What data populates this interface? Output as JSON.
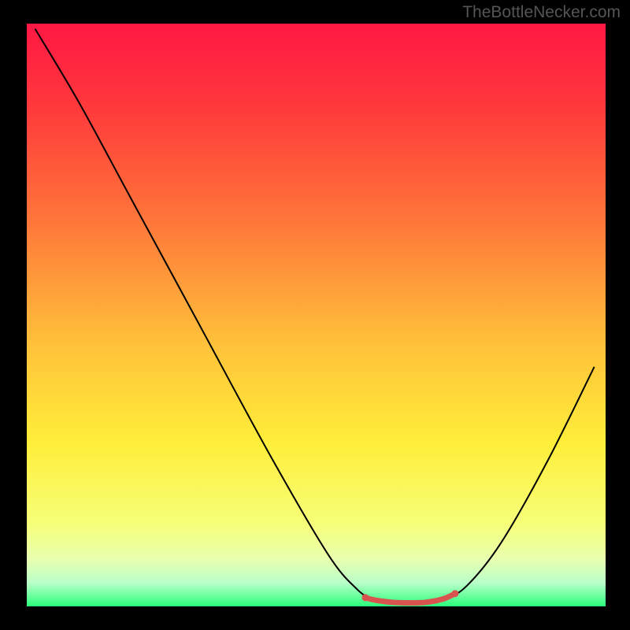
{
  "watermark": "TheBottleNecker.com",
  "chart_data": {
    "type": "line",
    "title": "",
    "xlabel": "",
    "ylabel": "",
    "xlim": [
      0,
      100
    ],
    "ylim": [
      0,
      100
    ],
    "background_gradient": {
      "stops": [
        {
          "offset": 0,
          "color": "#ff1744"
        },
        {
          "offset": 0.15,
          "color": "#ff3b3b"
        },
        {
          "offset": 0.35,
          "color": "#ff7a3a"
        },
        {
          "offset": 0.55,
          "color": "#ffc13a"
        },
        {
          "offset": 0.72,
          "color": "#ffee3a"
        },
        {
          "offset": 0.86,
          "color": "#f6ff7a"
        },
        {
          "offset": 0.92,
          "color": "#e8ffb0"
        },
        {
          "offset": 0.96,
          "color": "#b8ffc8"
        },
        {
          "offset": 1.0,
          "color": "#2bff7a"
        }
      ]
    },
    "series": [
      {
        "name": "bottleneck-curve",
        "color": "#000000",
        "width": 2,
        "points": [
          {
            "x": 1.5,
            "y": 99
          },
          {
            "x": 9,
            "y": 86.5
          },
          {
            "x": 18,
            "y": 70
          },
          {
            "x": 30,
            "y": 48
          },
          {
            "x": 42,
            "y": 26
          },
          {
            "x": 52,
            "y": 9
          },
          {
            "x": 57,
            "y": 3
          },
          {
            "x": 60,
            "y": 1.2
          },
          {
            "x": 64,
            "y": 0.6
          },
          {
            "x": 68,
            "y": 0.6
          },
          {
            "x": 72,
            "y": 1.2
          },
          {
            "x": 76,
            "y": 3.5
          },
          {
            "x": 82,
            "y": 11
          },
          {
            "x": 90,
            "y": 25
          },
          {
            "x": 98,
            "y": 41
          }
        ]
      },
      {
        "name": "flat-zone-marker",
        "color": "#d9534f",
        "width": 7,
        "points": [
          {
            "x": 58.5,
            "y": 1.5
          },
          {
            "x": 60,
            "y": 1.1
          },
          {
            "x": 63,
            "y": 0.7
          },
          {
            "x": 66,
            "y": 0.6
          },
          {
            "x": 69,
            "y": 0.7
          },
          {
            "x": 72,
            "y": 1.3
          },
          {
            "x": 74,
            "y": 2.2
          }
        ]
      }
    ],
    "marker_dots": [
      {
        "x": 58.5,
        "y": 1.5,
        "r": 4.5,
        "color": "#d9534f"
      },
      {
        "x": 74,
        "y": 2.2,
        "r": 4.5,
        "color": "#d9534f"
      }
    ]
  }
}
